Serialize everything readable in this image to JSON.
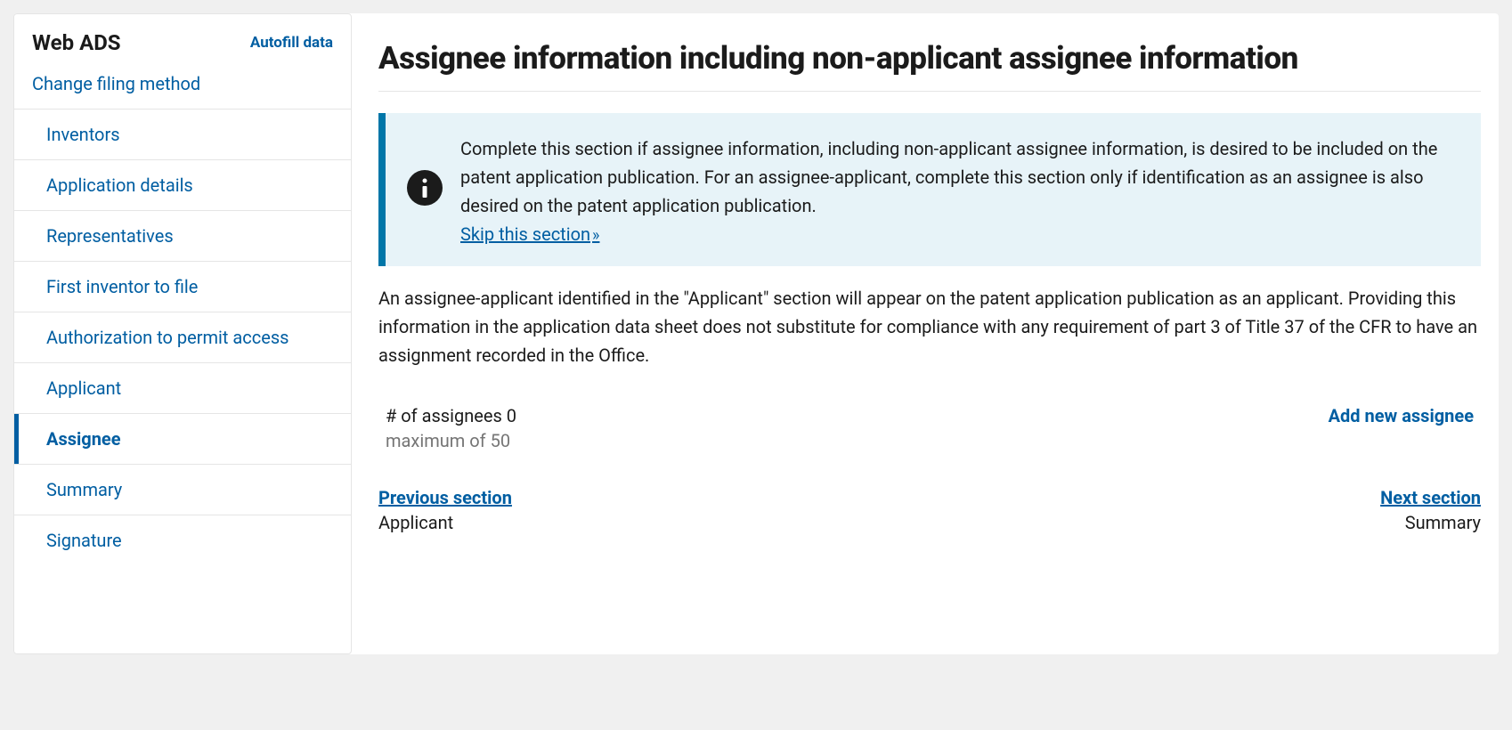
{
  "sidebar": {
    "title": "Web ADS",
    "autofill": "Autofill data",
    "change_filing": "Change filing method",
    "items": [
      {
        "label": "Inventors"
      },
      {
        "label": "Application details"
      },
      {
        "label": "Representatives"
      },
      {
        "label": "First inventor to file"
      },
      {
        "label": "Authorization to permit access"
      },
      {
        "label": "Applicant"
      },
      {
        "label": "Assignee"
      },
      {
        "label": "Summary"
      },
      {
        "label": "Signature"
      }
    ]
  },
  "main": {
    "title": "Assignee information including non-applicant assignee information",
    "info_text": "Complete this section if assignee information, including non-applicant assignee information, is desired to be included on the patent application publication. For an assignee-applicant, complete this section only if identification as an assignee is also desired on the patent application publication.",
    "skip_label": " Skip this section",
    "description": "An assignee-applicant identified in the \"Applicant\" section will appear on the patent application publication as an applicant. Providing this information in the application data sheet does not substitute for compliance with any requirement of part 3 of Title 37 of the CFR to have an assignment recorded in the Office.",
    "count_label": "# of assignees 0",
    "count_max": "maximum of 50",
    "add_label": "Add new assignee",
    "prev_label": "Previous section",
    "prev_sub": "Applicant",
    "next_label": "Next section",
    "next_sub": "Summary"
  }
}
